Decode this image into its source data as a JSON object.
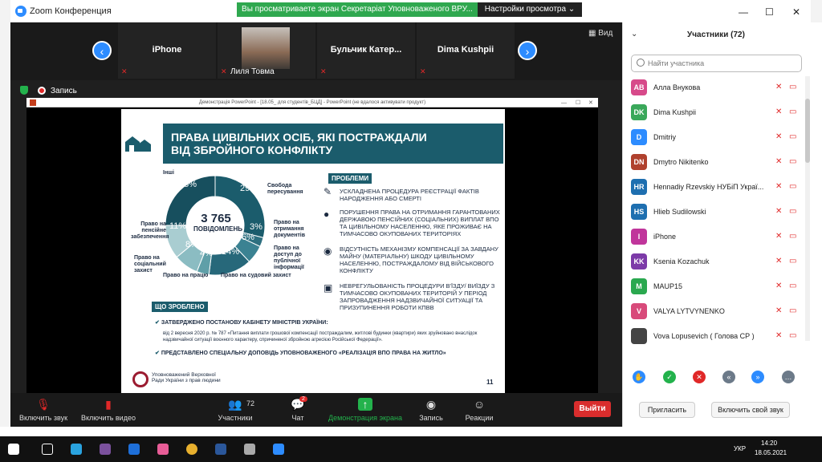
{
  "window": {
    "title": "Zoom Конференция"
  },
  "share_banner": "Вы просматриваете экран Секретаріат Уповноваженого ВРУ...",
  "view_settings": "Настройки просмотра ⌄",
  "gallery": {
    "tiles": [
      "iPhone",
      "Лиля Товма",
      "Бульчик  Катер...",
      "Dima Kushpii"
    ],
    "view_label": "Вид"
  },
  "recording": {
    "label": "Запись"
  },
  "ppt": {
    "title": "Демонстрація PowerPoint - [18.05_ для студентів_БЦД] - PowerPoint (не вдалося активувати продукт)"
  },
  "slide": {
    "title_line1": "ПРАВА ЦИВІЛЬНИХ ОСІБ, ЯКІ ПОСТРАЖДАЛИ",
    "title_line2": "ВІД ЗБРОЙНОГО КОНФЛІКТУ",
    "problems_label": "ПРОБЛЕМИ",
    "problems": [
      "УСКЛАДНЕНА ПРОЦЕДУРА РЕЄСТРАЦІЇ ФАКТІВ НАРОДЖЕННЯ АБО СМЕРТІ",
      "ПОРУШЕННЯ ПРАВА НА ОТРИМАННЯ ГАРАНТОВАНИХ ДЕРЖАВОЮ ПЕНСІЙНИХ (СОЦІАЛЬНИХ) ВИПЛАТ ВПО ТА ЦИВІЛЬНОМУ НАСЕЛЕННЮ, ЯКЕ ПРОЖИВАЄ НА ТИМЧАСОВО ОКУПОВАНИХ ТЕРИТОРІЯХ",
      "ВІДСУТНІСТЬ МЕХАНІЗМУ КОМПЕНСАЦІЇ ЗА ЗАВДАНУ МАЙНУ (МАТЕРІАЛЬНУ) ШКОДУ ЦИВІЛЬНОМУ НАСЕЛЕННЮ, ПОСТРАЖДАЛОМУ ВІД ВІЙСЬКОВОГО КОНФЛІКТУ",
      "НЕВРЕГУЛЬОВАНІСТЬ ПРОЦЕДУРИ В'ЇЗДУ/ ВИЇЗДУ З ТИМЧАСОВО ОКУПОВАНИХ ТЕРИТОРІЙ У ПЕРІОД ЗАПРОВАДЖЕННЯ НАДЗВИЧАЙНОЇ СИТУАЦІЇ ТА ПРИЗУПИНЕННЯ РОБОТИ КПВВ"
    ],
    "donut_total": "3 765",
    "donut_sub": "ПОВІДОМЛЕНЬ",
    "done_label": "ЩО ЗРОБЛЕНО",
    "done_1": "ЗАТВЕРДЖЕНО ПОСТАНОВУ КАБІНЕТУ МІНІСТРІВ УКРАЇНИ:",
    "done_1_sub": "від 2 вересня 2020 р. № 787 «Питання виплати грошової компенсації постраждалим, житлові будинки (квартири) яких зруйновано внаслідок надзвичайної ситуації воєнного характеру, спричиненої збройною агресією Російської Федерації».",
    "done_2": "ПРЕДСТАВЛЕНО СПЕЦІАЛЬНУ ДОПОВІДЬ УПОВНОВАЖЕНОГО «РЕАЛІЗАЦІЯ ВПО ПРАВА НА ЖИТЛО»",
    "footer": "Уповноважений Верховної Ради України з прав людини",
    "page": "11"
  },
  "chart_data": {
    "type": "pie",
    "categories": [
      "Свобода пересування",
      "Право на отримання документів",
      "Право на доступ до публічної інформації",
      "Право на судовий захист",
      "Право на працю",
      "Право на соціальний захист",
      "Право на пенсійне забезпечення",
      "Інші"
    ],
    "values": [
      29,
      3,
      6,
      14,
      4,
      8,
      11,
      25
    ],
    "colors": [
      "#1b5c6c",
      "#2e7080",
      "#3b8292",
      "#27687a",
      "#5f9fa8",
      "#8bbcc2",
      "#a9cdd1",
      "#174f5e"
    ]
  },
  "controls": {
    "unmute": "Включить звук",
    "video": "Включить видео",
    "participants": "Участники",
    "participants_count": "72",
    "chat": "Чат",
    "chat_badge": "2",
    "share": "Демонстрация экрана",
    "record": "Запись",
    "reactions": "Реакции",
    "leave": "Выйти"
  },
  "panel": {
    "title": "Участники (72)",
    "search_placeholder": "Найти участника",
    "participants": [
      {
        "initials": "АВ",
        "name": "Алла Внукова",
        "color": "#d74a8a"
      },
      {
        "initials": "DK",
        "name": "Dima Kushpii",
        "color": "#3aa85a"
      },
      {
        "initials": "D",
        "name": "Dmitriy",
        "color": "#2d8cff"
      },
      {
        "initials": "DN",
        "name": "Dmytro Nikitenko",
        "color": "#b0412e"
      },
      {
        "initials": "HR",
        "name": "Hennadiy Rzevskiy НУБіП Украї...",
        "color": "#1e6fb0"
      },
      {
        "initials": "HS",
        "name": "Hlieb Sudilowski",
        "color": "#1e6fb0"
      },
      {
        "initials": "I",
        "name": "iPhone",
        "color": "#c0359b"
      },
      {
        "initials": "KK",
        "name": "Ksenia Kozachuk",
        "color": "#7c3aa8"
      },
      {
        "initials": "M",
        "name": "MAUP15",
        "color": "#2aa84f"
      },
      {
        "initials": "V",
        "name": "VALYA LYTVYNENKO",
        "color": "#d84a7a"
      },
      {
        "initials": "",
        "name": "Vova Lopusevich ( Голова СР )",
        "color": "#444444"
      }
    ],
    "invite": "Пригласить",
    "unmute_me": "Включить свой звук"
  },
  "taskbar": {
    "lang": "УКР",
    "time": "14:20",
    "date": "18.05.2021"
  }
}
